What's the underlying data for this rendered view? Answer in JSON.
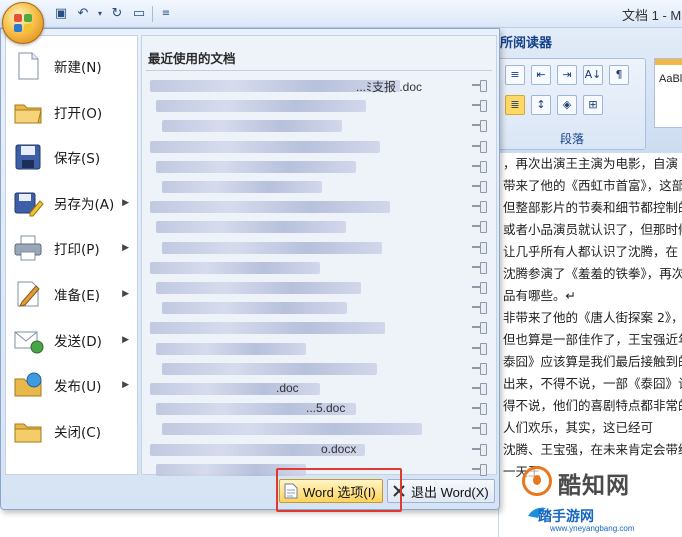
{
  "window": {
    "title": "文档 1 - M"
  },
  "quick_access": {
    "icons": [
      "save-icon",
      "undo-icon",
      "redo-icon",
      "print-preview-icon",
      "customize-icon"
    ]
  },
  "ribbon": {
    "tab_label": "所阅读器",
    "group_label": "段落",
    "styles_preview": "AaBl"
  },
  "office_menu": {
    "items": [
      {
        "label": "新建(N)",
        "icon": "new-document-icon"
      },
      {
        "label": "打开(O)",
        "icon": "open-folder-icon"
      },
      {
        "label": "保存(S)",
        "icon": "save-icon"
      },
      {
        "label": "另存为(A)",
        "icon": "save-as-icon",
        "arrow": "▶"
      },
      {
        "label": "打印(P)",
        "icon": "printer-icon",
        "arrow": "▶"
      },
      {
        "label": "准备(E)",
        "icon": "prepare-icon",
        "arrow": "▶"
      },
      {
        "label": "发送(D)",
        "icon": "send-icon",
        "arrow": "▶"
      },
      {
        "label": "发布(U)",
        "icon": "publish-icon",
        "arrow": "▶"
      },
      {
        "label": "关闭(C)",
        "icon": "close-folder-icon"
      }
    ],
    "recent_title": "最近使用的文档",
    "recent_documents": [
      {
        "text": "...ﾐ支报 .doc"
      },
      {
        "text": ""
      },
      {
        "text": ""
      },
      {
        "text": ""
      },
      {
        "text": ""
      },
      {
        "text": ""
      },
      {
        "text": ""
      },
      {
        "text": ""
      },
      {
        "text": ""
      },
      {
        "text": ""
      },
      {
        "text": ""
      },
      {
        "text": ""
      },
      {
        "text": ""
      },
      {
        "text": ""
      },
      {
        "text": ""
      },
      {
        "text": ".doc"
      },
      {
        "text": "...5.doc"
      },
      {
        "text": ""
      },
      {
        "text": "o.docx"
      },
      {
        "text": ""
      }
    ],
    "options_button": "Word 选项(I)",
    "exit_button": "退出 Word(X)"
  },
  "document": {
    "lines": [
      "，再次出演王主演为电影，自演",
      "带来了他的《西虹市首富》，这部电",
      "但整部影片的节奏和细节都控制的",
      "或者小品演员就认识了，但那时候的",
      "让几乎所有人都认识了沈腾，在《最",
      "沈腾参演了《羞羞的铁拳》，再次让",
      "品有哪些。↵",
      "非带来了他的《唐人街探案 2》，这",
      "但也算是一部佳作了，王宝强近年",
      "泰囧》应该算是我们最后接触到的他",
      "出来，不得不说，一部《泰囧》让他",
      "得不说，他们的喜剧特点都非常的有",
      "人们欢乐，其实，这已经可",
      "沈腾、王宝强，在未来肯定会带给我",
      "一天王"
    ]
  },
  "watermark": {
    "brand": "酷知网",
    "sub": "踏手游网",
    "url": "www.yneyangbang.com"
  }
}
